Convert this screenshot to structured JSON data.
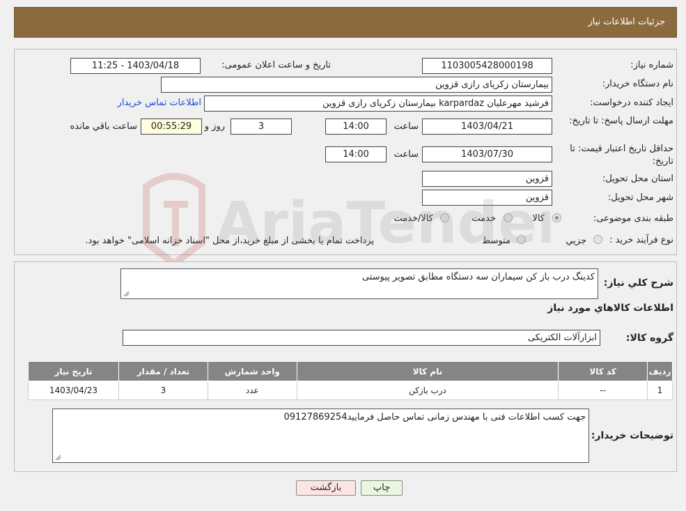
{
  "header": {
    "title": "جزئیات اطلاعات نیاز"
  },
  "fields": {
    "need_number_label": "شماره نیاز:",
    "need_number": "1103005428000198",
    "announce_label": "تاریخ و ساعت اعلان عمومی:",
    "announce_value": "1403/04/18 - 11:25",
    "buyer_org_label": "نام دستگاه خریدار:",
    "buyer_org": "بیمارستان زکریای رازی قزوین",
    "creator_label": "ایجاد کننده درخواست:",
    "creator": "فرشید مهرعلیان karpardaz بیمارستان زکریای رازی قزوین",
    "contact_link": "اطلاعات تماس خریدار",
    "deadline_label": "مهلت ارسال پاسخ: تا تاریخ:",
    "deadline_date": "1403/04/21",
    "time_word": "ساعت",
    "deadline_time": "14:00",
    "days_value": "3",
    "days_label": "روز و",
    "remaining_time": "00:55:29",
    "remaining_label": "ساعت باقي مانده",
    "validity_label": "حداقل تاریخ اعتبار قیمت: تا تاریخ:",
    "validity_date": "1403/07/30",
    "validity_time": "14:00",
    "province_label": "استان محل تحویل:",
    "province": "قزوین",
    "city_label": "شهر محل تحویل:",
    "city": "قزوین",
    "category_label": "طبقه بندی موضوعی:",
    "category_options": [
      "کالا",
      "خدمت",
      "کالا/خدمت"
    ],
    "process_label": "نوع فرآیند خرید :",
    "process_options": [
      "جزیي",
      "متوسط"
    ],
    "process_note": "پرداخت تمام یا بخشی از مبلغ خرید،از محل \"اسناد خزانه اسلامی\" خواهد بود."
  },
  "details": {
    "summary_label": "شرح کلي نیاز:",
    "summary": "کدینگ درب باز کن سیماران سه دستگاه مطابق تصویر پیوستی",
    "goods_info_title": "اطلاعات کالاهاي مورد نیاز",
    "goods_group_label": "گروه کالا:",
    "goods_group": "ابزارآلات الکتریکی",
    "table": {
      "headers": [
        "ردیف",
        "کد کالا",
        "نام کالا",
        "واحد شمارش",
        "تعداد / مقدار",
        "تاریخ نیاز"
      ],
      "rows": [
        [
          "1",
          "--",
          "درب بازکن",
          "عدد",
          "3",
          "1403/04/23"
        ]
      ]
    },
    "buyer_notes_label": "توضیحات خریدار:",
    "buyer_notes": "جهت کسب اطلاعات فنی با مهندس زمانی تماس حاصل فرمایید09127869254"
  },
  "buttons": {
    "print": "چاپ",
    "back": "بازگشت"
  },
  "watermark": {
    "text": "AriaTender.neT"
  },
  "colors": {
    "header_bg": "#8b6a3e",
    "table_header_bg": "#858585",
    "link": "#1a4fd6",
    "back_button_bg": "#fde4e4",
    "print_button_bg": "#e9f7e1",
    "time_box_bg": "#ffffe0"
  }
}
